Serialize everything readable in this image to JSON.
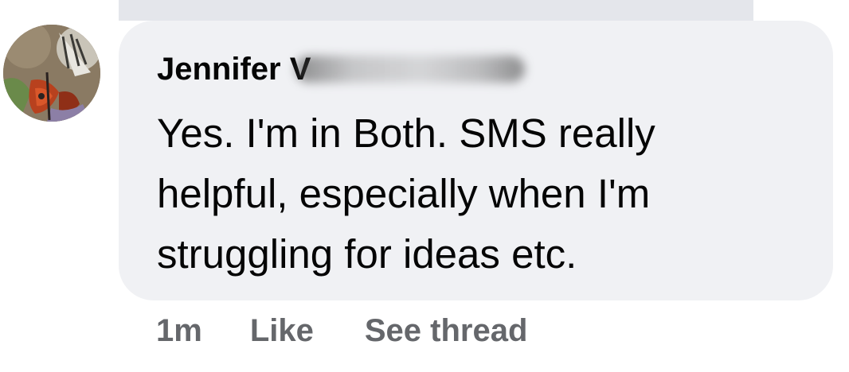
{
  "comment": {
    "author_name": "Jennifer V",
    "message": "Yes. I'm in Both. SMS really helpful, especially when I'm struggling for ideas etc."
  },
  "actions": {
    "timestamp": "1m",
    "like_label": "Like",
    "see_thread_label": "See thread"
  },
  "colors": {
    "bubble_background": "#f0f1f4",
    "text_primary": "#050505",
    "text_secondary": "#65676b"
  },
  "icons": {
    "avatar": "butterfly-photo-avatar"
  }
}
